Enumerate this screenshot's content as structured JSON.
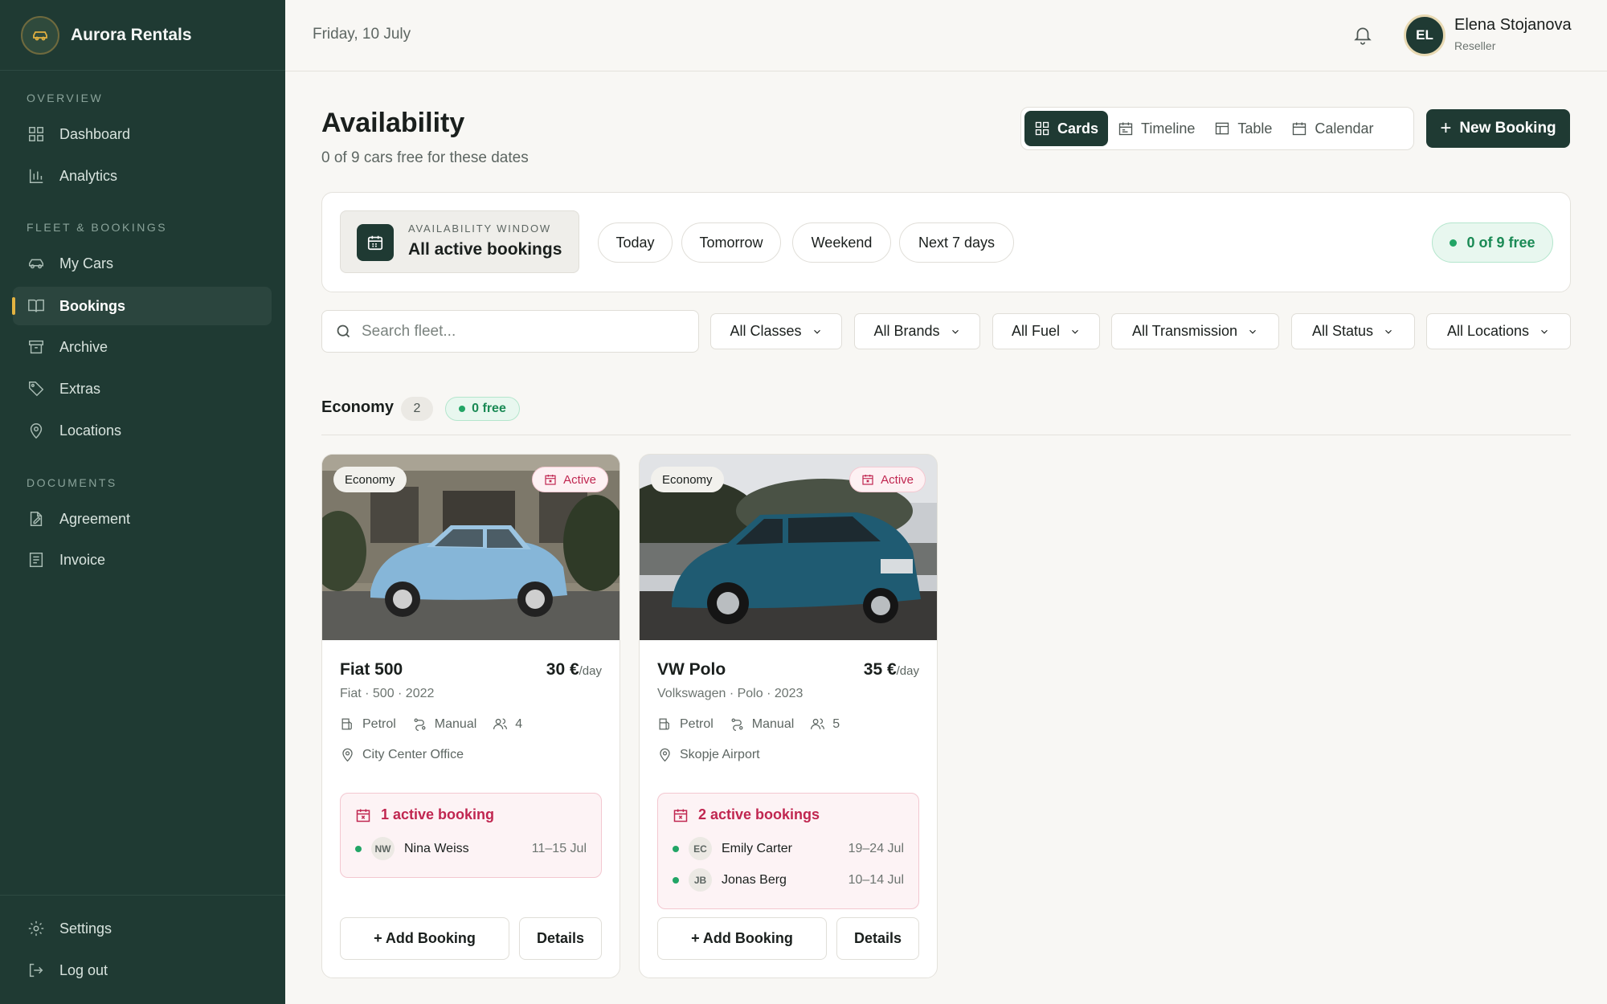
{
  "app": {
    "name": "Aurora Rentals"
  },
  "sidebar": {
    "sections": [
      "OVERVIEW",
      "FLEET & BOOKINGS",
      "DOCUMENTS"
    ],
    "items": [
      {
        "label": "Dashboard",
        "icon": "grid-icon"
      },
      {
        "label": "Analytics",
        "icon": "bar-chart-icon"
      },
      {
        "label": "My Cars",
        "icon": "car-icon"
      },
      {
        "label": "Bookings",
        "icon": "book-icon",
        "active": true
      },
      {
        "label": "Archive",
        "icon": "archive-icon"
      },
      {
        "label": "Extras",
        "icon": "tag-icon"
      },
      {
        "label": "Locations",
        "icon": "map-pin-icon"
      },
      {
        "label": "Agreement",
        "icon": "document-edit-icon"
      },
      {
        "label": "Invoice",
        "icon": "invoice-icon"
      }
    ],
    "bottom": [
      {
        "label": "Settings",
        "icon": "gear-icon"
      },
      {
        "label": "Log out",
        "icon": "logout-icon"
      }
    ]
  },
  "topbar": {
    "date": "Friday, 10 July",
    "user": {
      "initials": "EL",
      "name": "Elena Stojanova",
      "role": "Reseller"
    }
  },
  "page": {
    "title": "Availability",
    "subtitle": "0 of 9 cars free for these dates",
    "views": [
      "Cards",
      "Timeline",
      "Table",
      "Calendar"
    ],
    "active_view": "Cards",
    "new_booking_label": "New Booking"
  },
  "window": {
    "label": "AVAILABILITY WINDOW",
    "value": "All active bookings",
    "presets": [
      "Today",
      "Tomorrow",
      "Weekend",
      "Next 7 days"
    ],
    "free_badge": "0 of 9 free"
  },
  "filters": {
    "search_placeholder": "Search fleet...",
    "dropdowns": [
      "All Classes",
      "All Brands",
      "All Fuel",
      "All Transmission",
      "All Status",
      "All Locations"
    ]
  },
  "group": {
    "title": "Economy",
    "count": "2",
    "free": "0 free"
  },
  "cars": [
    {
      "class": "Economy",
      "status": "Active",
      "name": "Fiat 500",
      "price": "30 €",
      "unit": "/day",
      "meta": "Fiat · 500 · 2022",
      "fuel": "Petrol",
      "transmission": "Manual",
      "seats": "4",
      "location": "City Center Office",
      "bookings_label": "1 active booking",
      "bookings": [
        {
          "initials": "NW",
          "name": "Nina Weiss",
          "dates": "11–15 Jul"
        }
      ],
      "add_label": "+ Add Booking",
      "details_label": "Details"
    },
    {
      "class": "Economy",
      "status": "Active",
      "name": "VW Polo",
      "price": "35 €",
      "unit": "/day",
      "meta": "Volkswagen · Polo · 2023",
      "fuel": "Petrol",
      "transmission": "Manual",
      "seats": "5",
      "location": "Skopje Airport",
      "bookings_label": "2 active bookings",
      "bookings": [
        {
          "initials": "EC",
          "name": "Emily Carter",
          "dates": "19–24 Jul"
        },
        {
          "initials": "JB",
          "name": "Jonas Berg",
          "dates": "10–14 Jul"
        }
      ],
      "add_label": "+ Add Booking",
      "details_label": "Details"
    }
  ],
  "colors": {
    "sidebar": "#1f3a33",
    "accent": "#e3b341",
    "free": "#22a566",
    "active": "#c02650"
  }
}
